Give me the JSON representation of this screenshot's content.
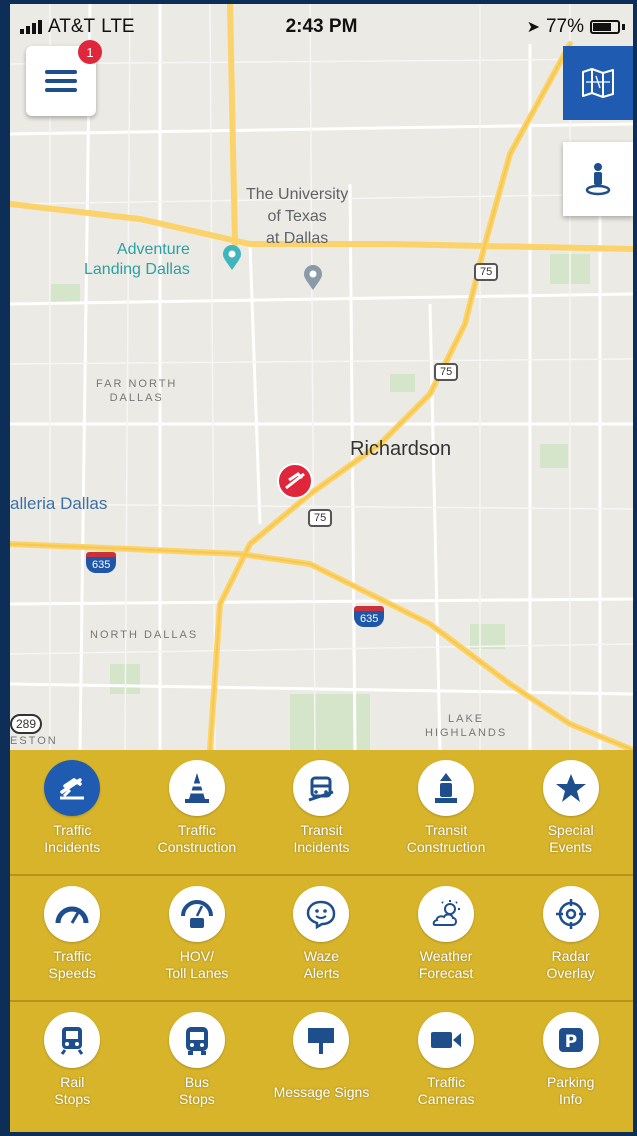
{
  "status_bar": {
    "carrier": "AT&T",
    "network": "LTE",
    "time": "2:43 PM",
    "battery": "77%",
    "battery_level": 0.77
  },
  "menu": {
    "badge_count": "1"
  },
  "map": {
    "labels": {
      "university": "The University\nof Texas\nat Dallas",
      "adventure": "Adventure\nLanding Dallas",
      "far_north_dallas": "FAR NORTH\nDALLAS",
      "richardson": "Richardson",
      "galleria": "alleria Dallas",
      "north_dallas": "NORTH DALLAS",
      "lake_highlands": "LAKE\nHIGHLANDS",
      "preston": "ESTON"
    },
    "shields": {
      "us75_a": "75",
      "us75_b": "75",
      "us75_c": "75",
      "i635_a": "635",
      "i635_b": "635",
      "sh289": "289"
    }
  },
  "tray": {
    "rows": [
      [
        {
          "label": "Traffic\nIncidents",
          "icon": "traffic-incident-icon"
        },
        {
          "label": "Traffic\nConstruction",
          "icon": "traffic-cone-icon"
        },
        {
          "label": "Transit\nIncidents",
          "icon": "transit-incident-icon"
        },
        {
          "label": "Transit\nConstruction",
          "icon": "transit-construction-icon"
        },
        {
          "label": "Special\nEvents",
          "icon": "star-icon"
        }
      ],
      [
        {
          "label": "Traffic\nSpeeds",
          "icon": "speedometer-icon"
        },
        {
          "label": "HOV/\nToll Lanes",
          "icon": "hov-gauge-icon"
        },
        {
          "label": "Waze\nAlerts",
          "icon": "waze-icon"
        },
        {
          "label": "Weather\nForecast",
          "icon": "weather-icon"
        },
        {
          "label": "Radar\nOverlay",
          "icon": "radar-icon"
        }
      ],
      [
        {
          "label": "Rail\nStops",
          "icon": "rail-icon"
        },
        {
          "label": "Bus\nStops",
          "icon": "bus-icon"
        },
        {
          "label": "Message Signs",
          "icon": "message-sign-icon"
        },
        {
          "label": "Traffic\nCameras",
          "icon": "camera-icon"
        },
        {
          "label": "Parking\nInfo",
          "icon": "parking-icon"
        }
      ]
    ]
  },
  "colors": {
    "brand_blue": "#1f5bb0",
    "tray_gold": "#d7b42a",
    "incident_red": "#e0263a"
  }
}
